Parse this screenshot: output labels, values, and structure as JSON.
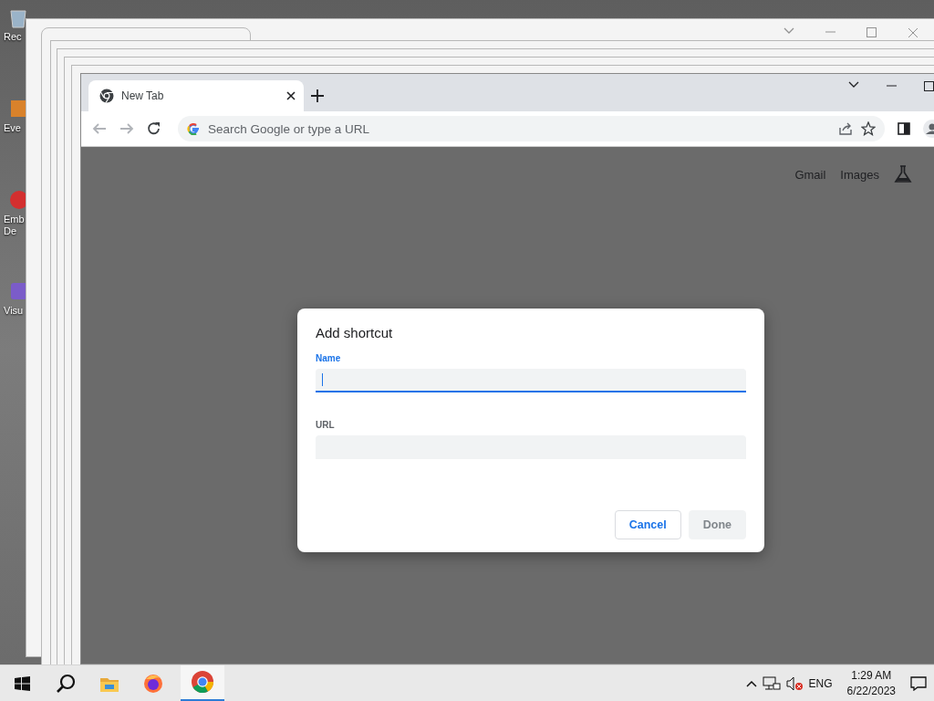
{
  "desktop_icons": [
    {
      "label": "Rec"
    },
    {
      "label": "Eve"
    },
    {
      "label": "Emb De"
    },
    {
      "label": "Visu"
    }
  ],
  "browser": {
    "tabs": [
      {
        "title": "New Tab",
        "selected": true
      }
    ],
    "address_bar": {
      "placeholder": "Search Google or type a URL"
    },
    "header_links": [
      "Gmail",
      "Images"
    ]
  },
  "dialog": {
    "title": "Add shortcut",
    "fields": [
      {
        "label": "Name",
        "focused": true
      },
      {
        "label": "URL",
        "focused": false
      }
    ],
    "buttons": [
      {
        "label": "Cancel",
        "disabled": false
      },
      {
        "label": "Done",
        "disabled": true
      }
    ]
  },
  "taskbar": {
    "apps": [
      {
        "kind": "folder",
        "active": false
      },
      {
        "kind": "firefox",
        "active": false
      },
      {
        "kind": "chrome",
        "active": true
      }
    ],
    "language": "ENG",
    "time": "1:29 AM",
    "date": "6/22/2023"
  }
}
